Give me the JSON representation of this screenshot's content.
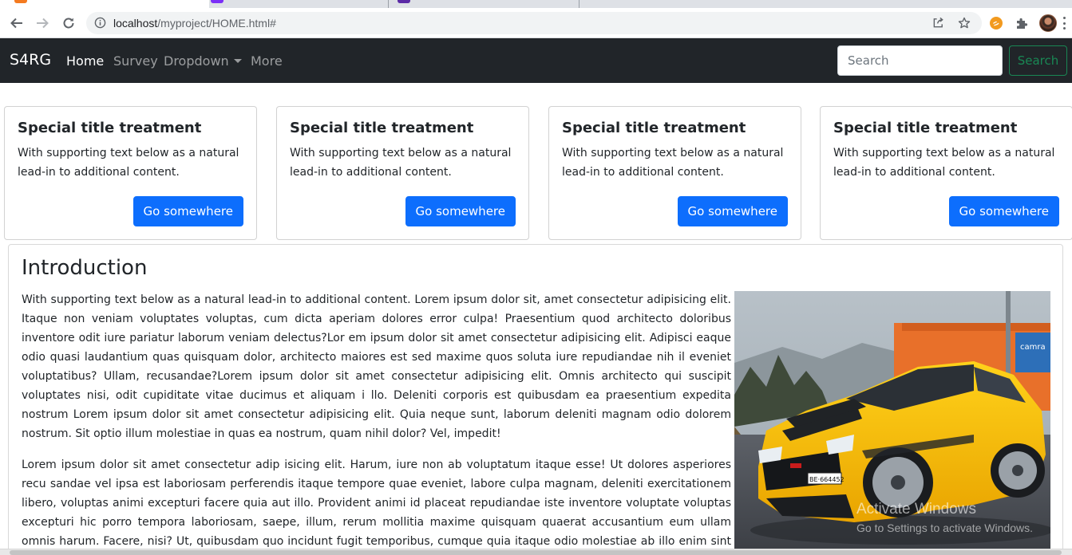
{
  "browser": {
    "url_host": "localhost",
    "url_path": "/myproject/HOME.html#",
    "tab_favicon_colors": [
      "#f47a20",
      "#7b2ff7",
      "#5b2aa6"
    ]
  },
  "navbar": {
    "brand": "S4RG",
    "links": [
      {
        "label": "Home",
        "active": true
      },
      {
        "label": "Survey",
        "active": false
      },
      {
        "label": "Dropdown",
        "active": false
      },
      {
        "label": "More",
        "active": false
      }
    ],
    "search_placeholder": "Search",
    "search_button": "Search",
    "colors": {
      "background": "#212529",
      "success": "#198754"
    }
  },
  "cards": [
    {
      "title": "Special title treatment",
      "text": "With supporting text below as a natural lead-in to additional content.",
      "button": "Go somewhere"
    },
    {
      "title": "Special title treatment",
      "text": "With supporting text below as a natural lead-in to additional content.",
      "button": "Go somewhere"
    },
    {
      "title": "Special title treatment",
      "text": "With supporting text below as a natural lead-in to additional content.",
      "button": "Go somewhere"
    },
    {
      "title": "Special title treatment",
      "text": "With supporting text below as a natural lead-in to additional content.",
      "button": "Go somewhere"
    }
  ],
  "primary_color": "#0d6efd",
  "introduction": {
    "title": "Introduction",
    "paragraph_1": "With supporting text below as a natural lead-in to additional content. Lorem ipsum dolor sit, amet consectetur adipisicing elit. Itaque non veniam voluptates voluptas, cum dicta aperiam dolores error culpa! Praesentium quod architecto doloribus inventore odit iure pariatur laborum veniam delectus?Lor em ipsum dolor sit amet consectetur adipisicing elit. Adipisci eaque odio quasi laudantium quas quisquam dolor, architecto maiores est sed maxime quos soluta iure repudiandae nih il eveniet voluptatibus? Ullam, recusandae?Lorem ipsum dolor sit amet consectetur adipisicing elit. Omnis architecto qui suscipit voluptates nisi, odit cupiditate vitae ducimus et aliquam i llo. Deleniti corporis est quibusdam ea praesentium expedita nostrum Lorem ipsum dolor sit amet consectetur adipisicing elit. Quia neque sunt, laborum deleniti magnam odio dolorem nostrum. Sit optio illum molestiae in quas ea nostrum, quam nihil dolor? Vel, impedit!",
    "paragraph_2": "Lorem ipsum dolor sit amet consectetur adip isicing elit. Harum, iure non ab voluptatum itaque esse! Ut dolores asperiores recu sandae vel ipsa est laboriosam perferendis itaque tempore quae eveniet, labore culpa magnam, deleniti exercitationem libero, voluptas animi excepturi facere quia aut illo. Provident animi id placeat repudiandae iste inventore voluptate voluptas excepturi hic porro tempora laboriosam, saepe, illum, rerum mollitia maxime quisquam quaerat accusantium eum ullam omnis harum. Facere, nisi? Ut, quibusdam quo incidunt fugit temporibus, cumque quia itaque odio molestiae ab illo enim sint quae asperiores",
    "image": {
      "subject": "yellow sports car",
      "store_sign": "camra",
      "license_plate": "BE·664452"
    }
  },
  "windows_watermark": {
    "line1": "Activate Windows",
    "line2": "Go to Settings to activate Windows."
  }
}
